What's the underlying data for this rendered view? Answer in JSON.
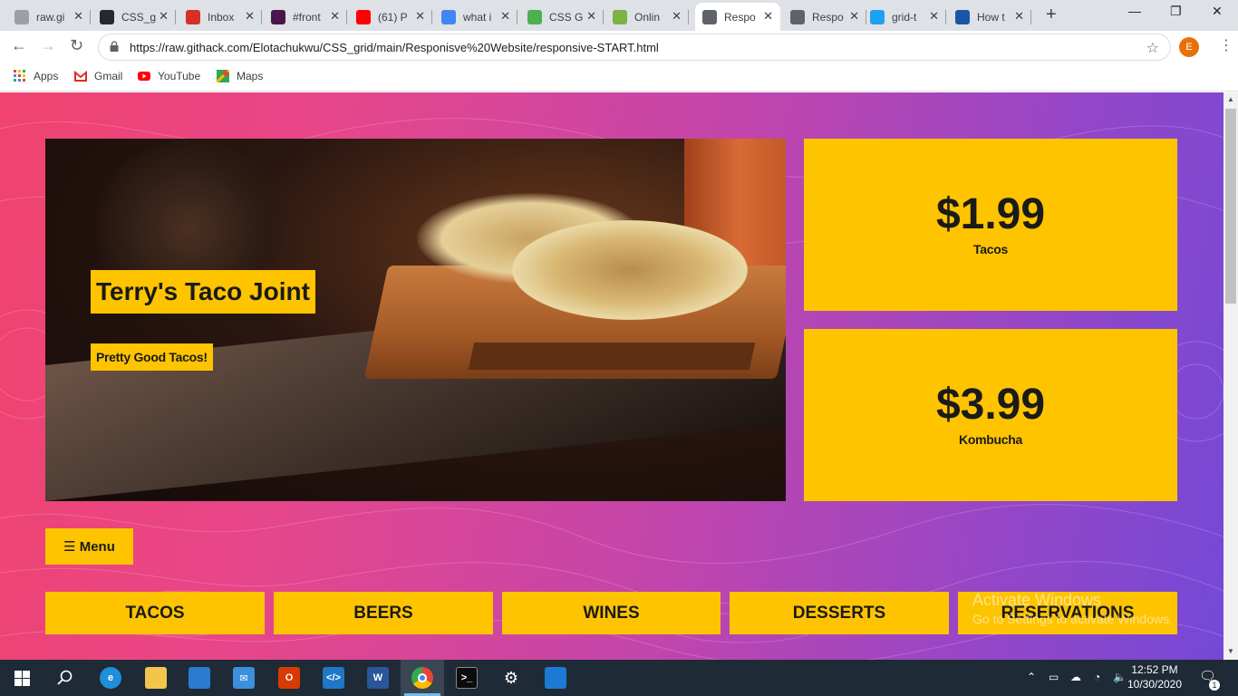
{
  "browser": {
    "tabs": [
      {
        "title": "raw.gi",
        "icon": "githack-icon",
        "color": "#9aa0a6"
      },
      {
        "title": "CSS_g",
        "icon": "github-icon",
        "color": "#24292e"
      },
      {
        "title": "Inbox",
        "icon": "gmail-icon",
        "color": "#d93025"
      },
      {
        "title": "#front",
        "icon": "slack-icon",
        "color": "#4a154b"
      },
      {
        "title": "(61) P",
        "icon": "youtube-icon",
        "color": "#ff0000"
      },
      {
        "title": "what i",
        "icon": "google-icon",
        "color": "#4285f4"
      },
      {
        "title": "CSS G",
        "icon": "w3-icon",
        "color": "#4caf50"
      },
      {
        "title": "Onlin",
        "icon": "download-icon",
        "color": "#7cb342"
      },
      {
        "title": "Respo",
        "icon": "globe-icon",
        "color": "#5f6368",
        "active": true
      },
      {
        "title": "Respo",
        "icon": "globe-icon",
        "color": "#5f6368"
      },
      {
        "title": "grid-t",
        "icon": "bird-icon",
        "color": "#1da1f2"
      },
      {
        "title": "How t",
        "icon": "h-icon",
        "color": "#1a56a8"
      }
    ],
    "url_display": "https://raw.githack.com/Elotachukwu/CSS_grid/main/Responisve%20Website/responsive-START.html",
    "profile_initial": "E",
    "bookmarks": [
      {
        "label": "Apps",
        "icon": "apps-grid-icon"
      },
      {
        "label": "Gmail",
        "icon": "gmail-icon"
      },
      {
        "label": "YouTube",
        "icon": "youtube-icon"
      },
      {
        "label": "Maps",
        "icon": "maps-icon"
      }
    ]
  },
  "site": {
    "hero_title": "Terry's Taco Joint",
    "hero_subtitle": "Pretty Good Tacos!",
    "prices": [
      {
        "amount": "$1.99",
        "label": "Tacos"
      },
      {
        "amount": "$3.99",
        "label": "Kombucha"
      }
    ],
    "menu_button": "☰ Menu",
    "nav": [
      "TACOS",
      "BEERS",
      "WINES",
      "DESSERTS",
      "RESERVATIONS"
    ],
    "accent_color": "#fec400",
    "gradient_colors": [
      "#f0436f",
      "#7449d6"
    ]
  },
  "watermark": {
    "line1": "Activate Windows",
    "line2": "Go to Settings to activate Windows."
  },
  "taskbar": {
    "time": "12:52 PM",
    "date": "10/30/2020",
    "notifications": "1"
  }
}
